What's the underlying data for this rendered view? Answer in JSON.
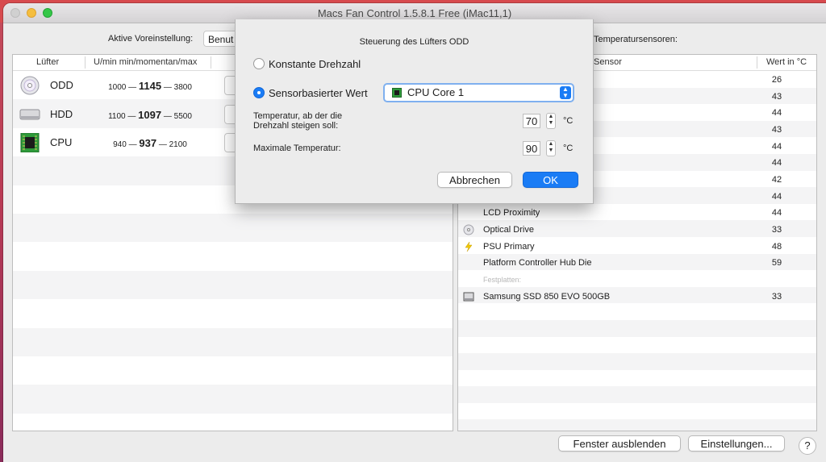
{
  "window": {
    "title": "Macs Fan Control 1.5.8.1 Free (iMac11,1)"
  },
  "preset": {
    "label": "Aktive Voreinstellung:",
    "value": "Benut"
  },
  "fans": {
    "headers": {
      "name": "Lüfter",
      "rpm": "U/min min/momentan/max"
    },
    "rows": [
      {
        "icon": "optical-drive-icon",
        "name": "ODD",
        "min": "1000",
        "sep1": "—",
        "current": "1145",
        "sep2": "—",
        "max": "3800"
      },
      {
        "icon": "hard-drive-icon",
        "name": "HDD",
        "min": "1100",
        "sep1": "—",
        "current": "1097",
        "sep2": "—",
        "max": "5500"
      },
      {
        "icon": "cpu-chip-icon",
        "name": "CPU",
        "min": "940",
        "sep1": "—",
        "current": "937",
        "sep2": "—",
        "max": "2100"
      }
    ]
  },
  "sensors": {
    "title": "Temperatursensoren:",
    "headers": {
      "name": "Sensor",
      "value": "Wert in °C"
    },
    "rows": [
      {
        "name": "",
        "value": "26",
        "icon": ""
      },
      {
        "name": "",
        "value": "43",
        "icon": ""
      },
      {
        "name": "",
        "value": "44",
        "icon": ""
      },
      {
        "name": "",
        "value": "43",
        "icon": ""
      },
      {
        "name": "",
        "value": "44",
        "icon": ""
      },
      {
        "name": "",
        "value": "44",
        "icon": ""
      },
      {
        "name": "",
        "value": "42",
        "icon": ""
      },
      {
        "name": "",
        "value": "44",
        "icon": ""
      },
      {
        "name": "LCD Proximity",
        "value": "44",
        "icon": ""
      },
      {
        "name": "Optical Drive",
        "value": "33",
        "icon": "optical-drive-icon"
      },
      {
        "name": "PSU Primary",
        "value": "48",
        "icon": "lightning-icon"
      },
      {
        "name": "Platform Controller Hub Die",
        "value": "59",
        "icon": ""
      },
      {
        "name": "Festplatten:",
        "value": "",
        "icon": "",
        "group": true
      },
      {
        "name": "Samsung SSD 850 EVO 500GB",
        "value": "33",
        "icon": "hard-drive-icon"
      }
    ]
  },
  "buttons": {
    "hide": "Fenster ausblenden",
    "settings": "Einstellungen...",
    "help": "?"
  },
  "dialog": {
    "title": "Steuerung des Lüfters ODD",
    "option_constant": "Konstante Drehzahl",
    "option_sensor": "Sensorbasierter Wert",
    "selected_option": "sensor",
    "sensor_select": "CPU Core 1",
    "start_temp_label": "Temperatur, ab der die Drehzahl steigen soll:",
    "start_temp_value": "70",
    "max_temp_label": "Maximale Temperatur:",
    "max_temp_value": "90",
    "unit": "°C",
    "cancel": "Abbrechen",
    "ok": "OK"
  },
  "colors": {
    "accent": "#1a7cf5",
    "desktop_top": "#d74a4e",
    "cpu_chip": "#2e9a3a"
  }
}
